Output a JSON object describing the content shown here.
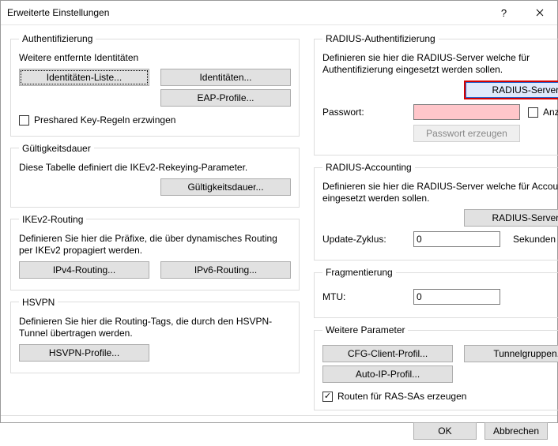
{
  "window": {
    "title": "Erweiterte Einstellungen",
    "help_label": "?",
    "close_label": "×"
  },
  "auth": {
    "legend": "Authentifizierung",
    "desc": "Weitere entfernte Identitäten",
    "identity_list_btn": "Identitäten-Liste...",
    "identities_btn": "Identitäten...",
    "eap_btn": "EAP-Profile...",
    "psk_checkbox": "Preshared Key-Regeln erzwingen",
    "psk_checked": false
  },
  "validity": {
    "legend": "Gültigkeitsdauer",
    "desc": "Diese Tabelle definiert die IKEv2-Rekeying-Parameter.",
    "btn": "Gültigkeitsdauer..."
  },
  "ikev2": {
    "legend": "IKEv2-Routing",
    "desc": "Definieren Sie hier die Präfixe, die über dynamisches Routing per IKEv2 propagiert werden.",
    "ipv4_btn": "IPv4-Routing...",
    "ipv6_btn": "IPv6-Routing..."
  },
  "hsvpn": {
    "legend": "HSVPN",
    "desc": "Definieren Sie hier die Routing-Tags, die durch den HSVPN-Tunnel übertragen werden.",
    "btn": "HSVPN-Profile..."
  },
  "radius_auth": {
    "legend": "RADIUS-Authentifizierung",
    "desc": "Definieren sie hier die RADIUS-Server welche für Authentifizierung eingesetzt werden sollen.",
    "server_btn": "RADIUS-Server...",
    "password_label": "Passwort:",
    "password_value": "",
    "show_checkbox": "Anzeigen",
    "show_checked": false,
    "gen_btn": "Passwort erzeugen"
  },
  "radius_acct": {
    "legend": "RADIUS-Accounting",
    "desc": "Definieren sie hier die RADIUS-Server welche für Accounting eingesetzt werden sollen.",
    "server_btn": "RADIUS-Server...",
    "update_label": "Update-Zyklus:",
    "update_value": "0",
    "update_unit": "Sekunden"
  },
  "frag": {
    "legend": "Fragmentierung",
    "mtu_label": "MTU:",
    "mtu_value": "0"
  },
  "other": {
    "legend": "Weitere Parameter",
    "cfg_btn": "CFG-Client-Profil...",
    "tunnel_btn": "Tunnelgruppen...",
    "autoip_btn": "Auto-IP-Profil...",
    "routes_checkbox": "Routen für RAS-SAs erzeugen",
    "routes_checked": true
  },
  "footer": {
    "ok": "OK",
    "cancel": "Abbrechen"
  }
}
